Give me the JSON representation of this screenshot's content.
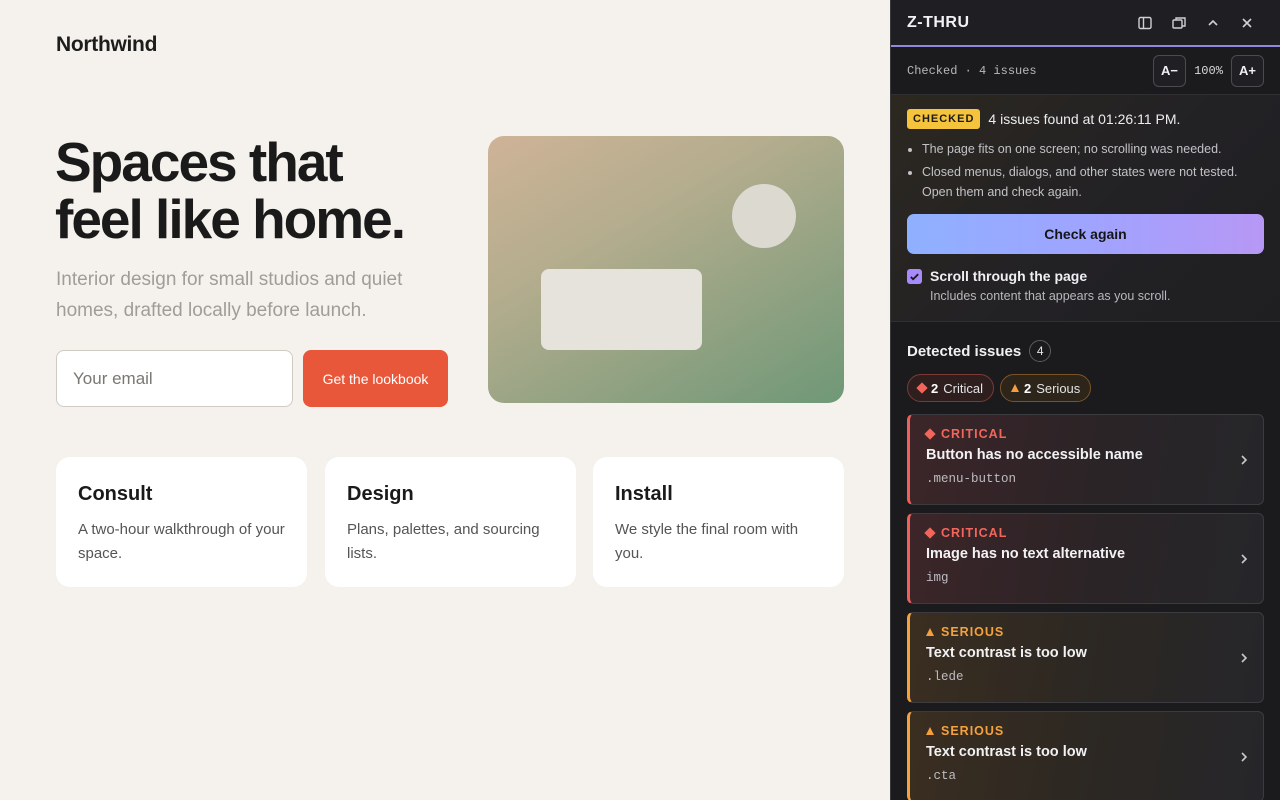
{
  "site": {
    "logo": "Northwind",
    "hero_line1": "Spaces that",
    "hero_line2": "feel like home.",
    "lede": "Interior design for small studios and quiet homes, drafted locally before launch.",
    "email_placeholder": "Your email",
    "cta_label": "Get the lookbook",
    "cards": [
      {
        "title": "Consult",
        "desc": "A two-hour walkthrough of your space."
      },
      {
        "title": "Design",
        "desc": "Plans, palettes, and sourcing lists."
      },
      {
        "title": "Install",
        "desc": "We style the final room with you."
      }
    ],
    "colors": {
      "accent": "#e8573a",
      "background": "#f5f2ed"
    }
  },
  "panel": {
    "title": "Z-THRU",
    "status": "Checked · 4 issues",
    "zoom_out_label": "A−",
    "zoom_value": "100%",
    "zoom_in_label": "A+",
    "summary": {
      "badge": "CHECKED",
      "text": "4 issues found at 01:26:11 PM.",
      "notes": [
        "The page fits on one screen; no scrolling was needed.",
        "Closed menus, dialogs, and other states were not tested. Open them and check again."
      ],
      "check_again_label": "Check again",
      "scroll_option_label": "Scroll through the page",
      "scroll_option_desc": "Includes content that appears as you scroll.",
      "scroll_option_checked": true
    },
    "issues_title": "Detected issues",
    "issues_count": "4",
    "chips": {
      "critical_count": "2",
      "critical_label": "Critical",
      "serious_count": "2",
      "serious_label": "Serious"
    },
    "issues": [
      {
        "severity": "CRITICAL",
        "title": "Button has no accessible name",
        "selector": ".menu-button"
      },
      {
        "severity": "CRITICAL",
        "title": "Image has no text alternative",
        "selector": "img"
      },
      {
        "severity": "SERIOUS",
        "title": "Text contrast is too low",
        "selector": ".lede"
      },
      {
        "severity": "SERIOUS",
        "title": "Text contrast is too low",
        "selector": ".cta"
      }
    ],
    "icons": [
      "sidebar-icon",
      "popout-icon",
      "chevron-up-icon",
      "close-icon"
    ],
    "colors": {
      "critical": "#f0605a",
      "serious": "#f5a23d",
      "checked_badge": "#f6c33c"
    }
  }
}
